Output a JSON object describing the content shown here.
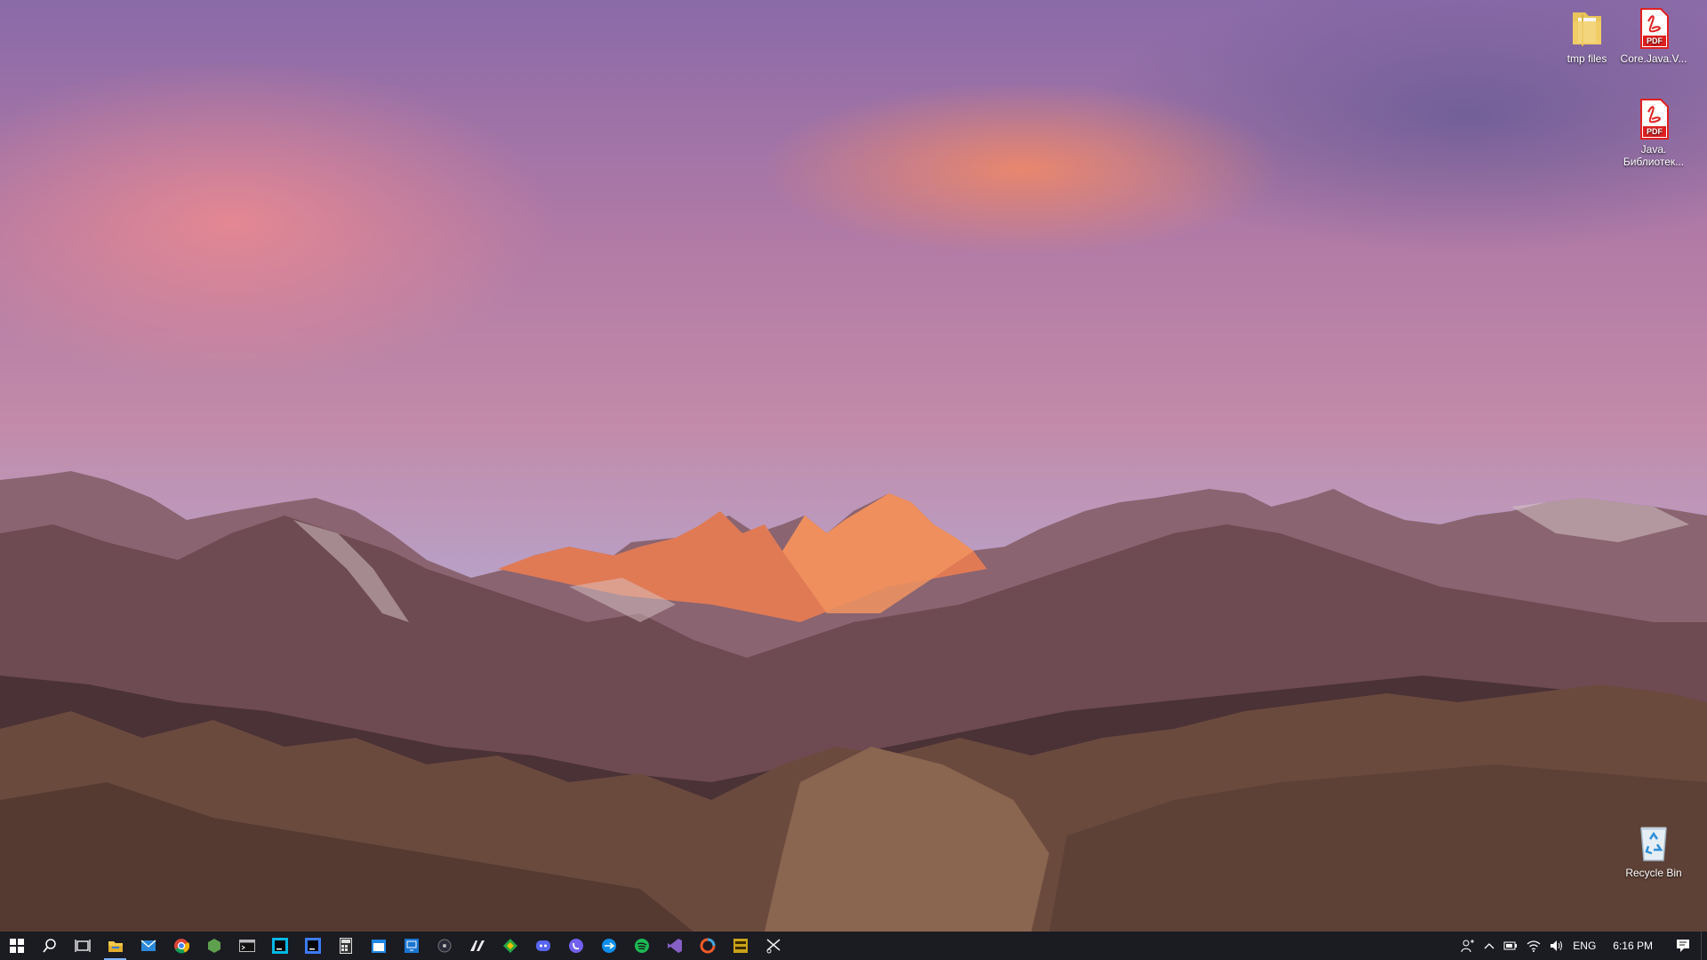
{
  "desktop": {
    "icons": [
      {
        "label": "tmp files",
        "icon": "folder-icon"
      },
      {
        "label": "Core.Java.V...",
        "icon": "pdf-file-icon"
      },
      {
        "label": "Java. Библиотек...",
        "icon": "pdf-file-icon"
      },
      {
        "label": "Recycle Bin",
        "icon": "recycle-bin-icon"
      }
    ],
    "pdf_badge": "PDF"
  },
  "taskbar": {
    "pinned": [
      "start-icon",
      "search-icon",
      "task-view-icon",
      "file-explorer-icon",
      "mail-icon",
      "chrome-icon",
      "node-icon",
      "terminal-icon",
      "webstorm-icon",
      "intellij-icon",
      "calculator-icon",
      "calendar-icon",
      "remote-desktop-icon",
      "obs-icon",
      "notion-icon",
      "gitkraken-icon",
      "discord-icon",
      "viber-icon",
      "teamviewer-icon",
      "spotify-icon",
      "visual-studio-icon",
      "browser-ring-icon",
      "dosbox-icon",
      "snipping-icon"
    ],
    "active_app": "file-explorer-icon",
    "tray": {
      "language": "ENG",
      "time": "6:16 PM"
    }
  },
  "colors": {
    "taskbar_bg": "#1b1b22",
    "accent": "#7fb2ff",
    "pdf_red": "#e02020"
  }
}
